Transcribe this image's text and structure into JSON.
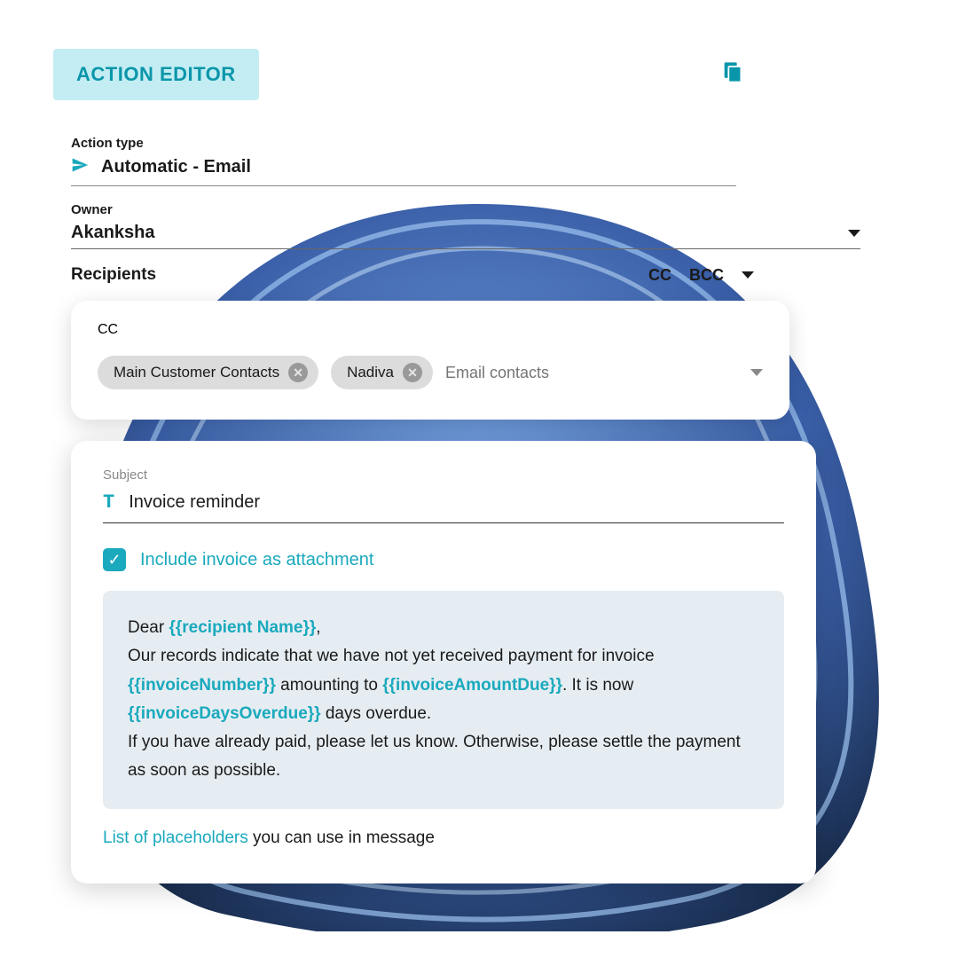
{
  "header": {
    "title": "ACTION EDITOR"
  },
  "action_type": {
    "label": "Action type",
    "value": "Automatic - Email"
  },
  "owner": {
    "label": "Owner",
    "value": "Akanksha"
  },
  "recipients": {
    "label": "Recipients",
    "cc_label": "CC",
    "bcc_label": "BCC"
  },
  "cc_section": {
    "label": "CC",
    "chips": [
      "Main Customer Contacts",
      "Nadiva"
    ],
    "placeholder": "Email contacts"
  },
  "subject": {
    "label": "Subject",
    "value": "Invoice reminder"
  },
  "attachment": {
    "label": "Include invoice as attachment",
    "checked": true
  },
  "message": {
    "parts": [
      {
        "t": "Dear "
      },
      {
        "p": "{{recipient Name}}"
      },
      {
        "t": ","
      },
      {
        "br": true
      },
      {
        "t": "Our records indicate that we have not yet received payment for invoice "
      },
      {
        "p": "{{invoiceNumber}}"
      },
      {
        "t": " amounting to "
      },
      {
        "p": "{{invoiceAmountDue}}"
      },
      {
        "t": ". It is now "
      },
      {
        "p": "{{invoiceDaysOverdue}}"
      },
      {
        "t": " days overdue."
      },
      {
        "br": true
      },
      {
        "t": "If you have already paid, please let us know. Otherwise, please settle the payment as soon as possible."
      }
    ]
  },
  "placeholders_link": {
    "link": "List of placeholders",
    "suffix": " you can use in message"
  }
}
